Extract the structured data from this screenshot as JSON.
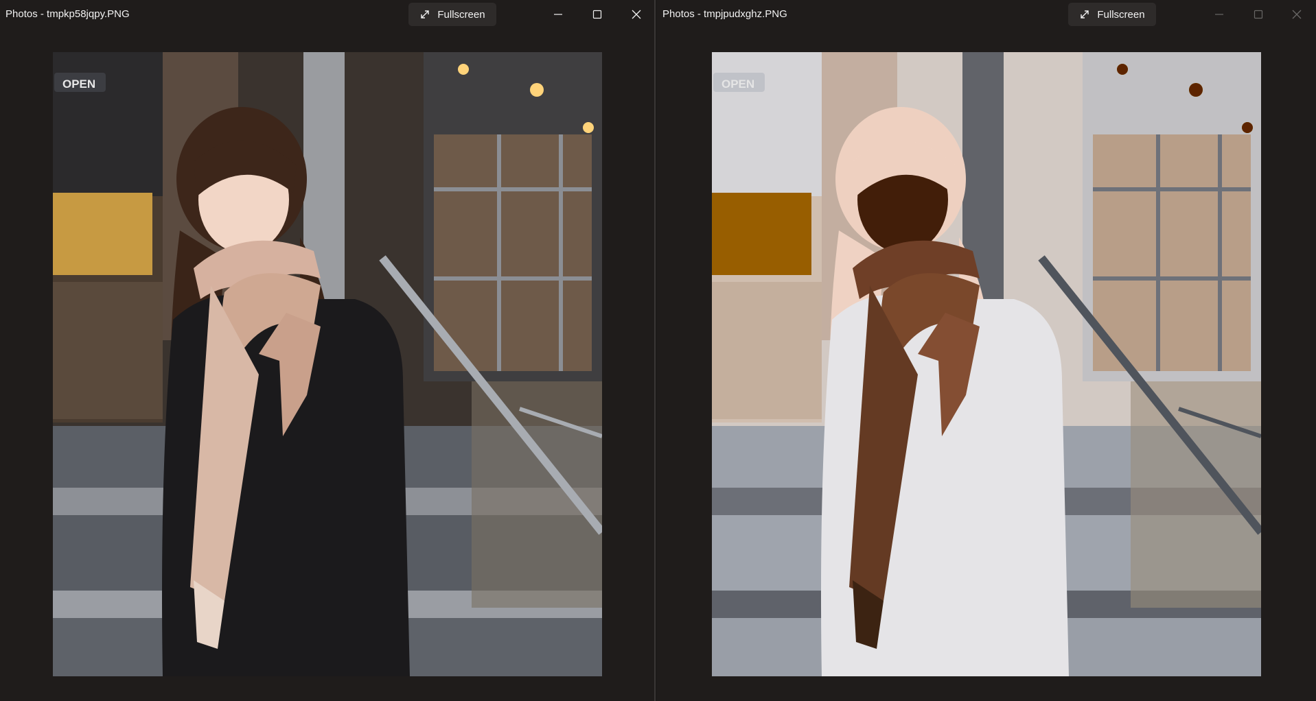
{
  "windows": [
    {
      "title": "Photos - tmpkp58jqpy.PNG",
      "fullscreen_label": "Fullscreen",
      "image_sign_text": "OPEN",
      "controls_active": true
    },
    {
      "title": "Photos - tmpjpudxghz.PNG",
      "fullscreen_label": "Fullscreen",
      "image_sign_text": "OPEN",
      "controls_active": false
    }
  ],
  "icons": {
    "fullscreen": "expand-diagonal-icon",
    "minimize": "minimize-icon",
    "maximize": "maximize-icon",
    "close": "close-icon"
  },
  "colors": {
    "window_bg": "#1f1c1b",
    "button_bg": "#2e2b2a",
    "text": "#f2f2f2"
  }
}
